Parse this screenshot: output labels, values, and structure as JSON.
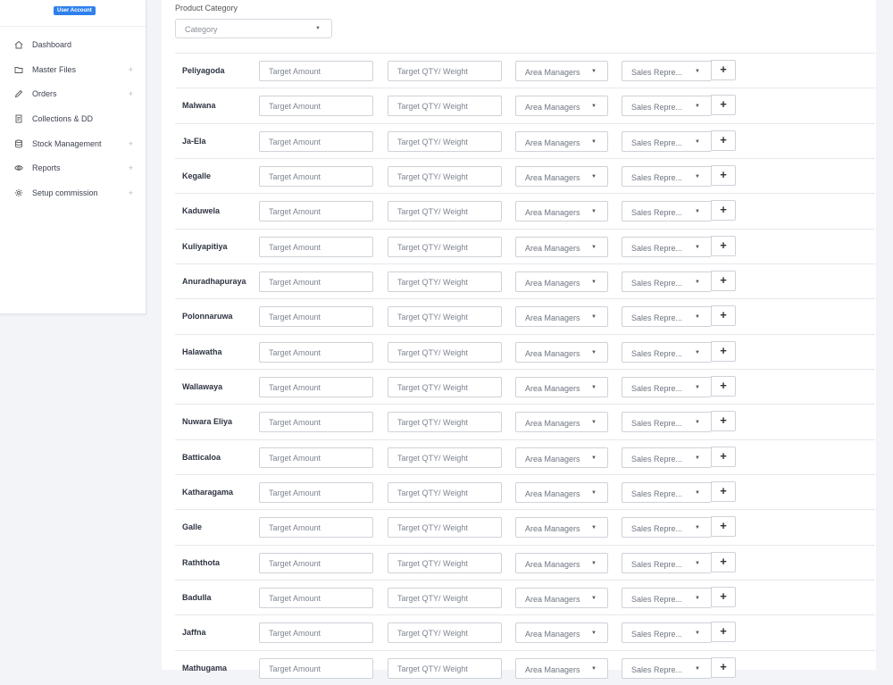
{
  "sidebar": {
    "badge": "User Account",
    "items": [
      {
        "label": "Dashboard",
        "icon": "home-icon",
        "expandable": false
      },
      {
        "label": "Master Files",
        "icon": "folder-icon",
        "expandable": true
      },
      {
        "label": "Orders",
        "icon": "pencil-icon",
        "expandable": true
      },
      {
        "label": "Collections & DD",
        "icon": "document-icon",
        "expandable": false
      },
      {
        "label": "Stock Management",
        "icon": "database-icon",
        "expandable": true
      },
      {
        "label": "Reports",
        "icon": "eye-icon",
        "expandable": true
      },
      {
        "label": "Setup commission",
        "icon": "gear-icon",
        "expandable": true
      }
    ],
    "expand_symbol": "+"
  },
  "filter": {
    "label": "Product Category",
    "placeholder": "Category",
    "caret": "▼"
  },
  "row_fields": {
    "amount_placeholder": "Target Amount",
    "qty_placeholder": "Target QTY/ Weight",
    "area_managers": "Area Managers",
    "sales_reps": "Sales Repre...",
    "caret": "▼",
    "add_symbol": "+"
  },
  "locations": [
    "Peliyagoda",
    "Malwana",
    "Ja-Ela",
    "Kegalle",
    "Kaduwela",
    "Kuliyapitiya",
    "Anuradhapuraya",
    "Polonnaruwa",
    "Halawatha",
    "Wallawaya",
    "Nuwara Eliya",
    "Batticaloa",
    "Katharagama",
    "Galle",
    "Raththota",
    "Badulla",
    "Jaffna",
    "Mathugama"
  ]
}
